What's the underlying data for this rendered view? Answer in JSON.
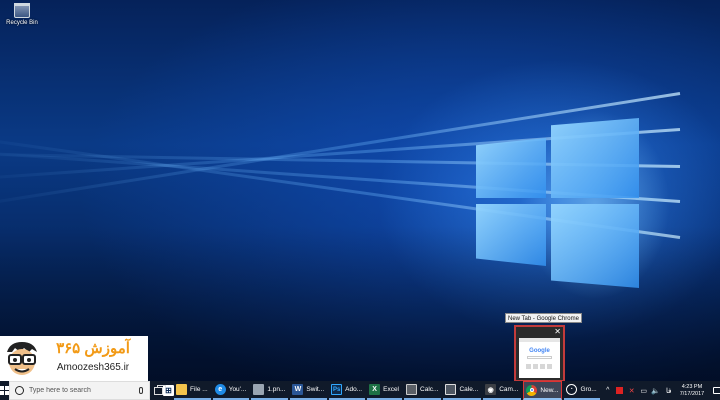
{
  "desktop": {
    "icons": [
      {
        "label": "Recycle Bin",
        "icon": "recycle-bin-icon"
      }
    ]
  },
  "watermark": {
    "brand_fa": "آموزش ۳۶۵",
    "brand_en": "Amoozesh365.ir"
  },
  "preview": {
    "title": "New Tab - Google Chrome",
    "close": "✕",
    "thumbnail_logo": "Google"
  },
  "taskbar": {
    "search_placeholder": "Type here to search",
    "apps": [
      {
        "label": "File ...",
        "icon": "file-explorer-icon",
        "color": "#f3c34b"
      },
      {
        "label": "You'...",
        "icon": "edge-icon",
        "color": "#1f8be6"
      },
      {
        "label": "1.pn...",
        "icon": "photo-viewer-icon",
        "color": "#9aa5b2"
      },
      {
        "label": "Swit...",
        "icon": "word-icon",
        "color": "#2b5797"
      },
      {
        "label": "Ado...",
        "icon": "photoshop-icon",
        "color": "#0e2b4d"
      },
      {
        "label": "Excel",
        "icon": "excel-icon",
        "color": "#1e7145"
      },
      {
        "label": "Calc...",
        "icon": "calculator-icon",
        "color": "#5a5f66"
      },
      {
        "label": "Cale...",
        "icon": "calendar-icon",
        "color": "#4e5661"
      },
      {
        "label": "Cam...",
        "icon": "camera-icon",
        "color": "#3c3f45"
      },
      {
        "label": "New...",
        "icon": "chrome-icon",
        "color": "#e8b42c",
        "active": true
      },
      {
        "label": "Gro...",
        "icon": "groove-music-icon",
        "color": "#2c2c2c"
      }
    ],
    "tray": {
      "lang": "فا",
      "time": "4:23 PM",
      "date": "7/17/2017"
    }
  },
  "colors": {
    "taskbar_bg": "#101a2a",
    "active_app_border": "#dd3333",
    "watermark_accent": "#f29a16"
  }
}
